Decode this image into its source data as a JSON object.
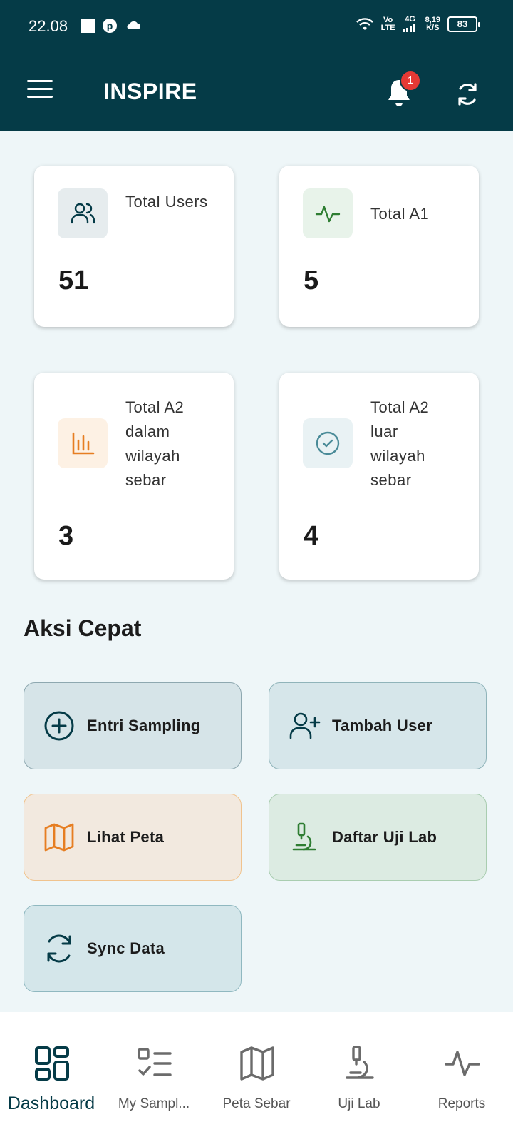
{
  "status_bar": {
    "time": "22.08",
    "network_top": "Vo",
    "network_bottom": "LTE",
    "signal_label": "4G",
    "speed_value": "8,19",
    "speed_unit": "K/S",
    "battery": "83"
  },
  "app_bar": {
    "title": "INSPIRE",
    "notification_count": "1"
  },
  "stats": [
    {
      "label": "Total Users",
      "value": "51",
      "icon": "users-icon",
      "color": "#053b47"
    },
    {
      "label": "Total A1",
      "value": "5",
      "icon": "activity-icon",
      "color": "#2e7d32"
    },
    {
      "label": "Total A2 dalam wilayah sebar",
      "value": "3",
      "icon": "bar-chart-icon",
      "color": "#e67e22"
    },
    {
      "label": "Total A2 luar wilayah sebar",
      "value": "4",
      "icon": "check-circle-icon",
      "color": "#4a8b98"
    }
  ],
  "quick_actions": {
    "title": "Aksi Cepat",
    "items": [
      {
        "label": "Entri Sampling",
        "icon": "plus-circle-icon"
      },
      {
        "label": "Tambah User",
        "icon": "user-plus-icon"
      },
      {
        "label": "Lihat Peta",
        "icon": "map-icon"
      },
      {
        "label": "Daftar Uji Lab",
        "icon": "microscope-icon"
      },
      {
        "label": "Sync Data",
        "icon": "sync-icon"
      }
    ]
  },
  "bottom_nav": [
    {
      "label": "Dashboard",
      "icon": "dashboard-icon",
      "active": true
    },
    {
      "label": "My Sampl...",
      "icon": "checklist-icon",
      "active": false
    },
    {
      "label": "Peta Sebar",
      "icon": "map-icon",
      "active": false
    },
    {
      "label": "Uji Lab",
      "icon": "microscope-icon",
      "active": false
    },
    {
      "label": "Reports",
      "icon": "activity-icon",
      "active": false
    }
  ],
  "colors": {
    "primary": "#053b47",
    "background": "#eef6f8",
    "badge": "#e53935"
  }
}
